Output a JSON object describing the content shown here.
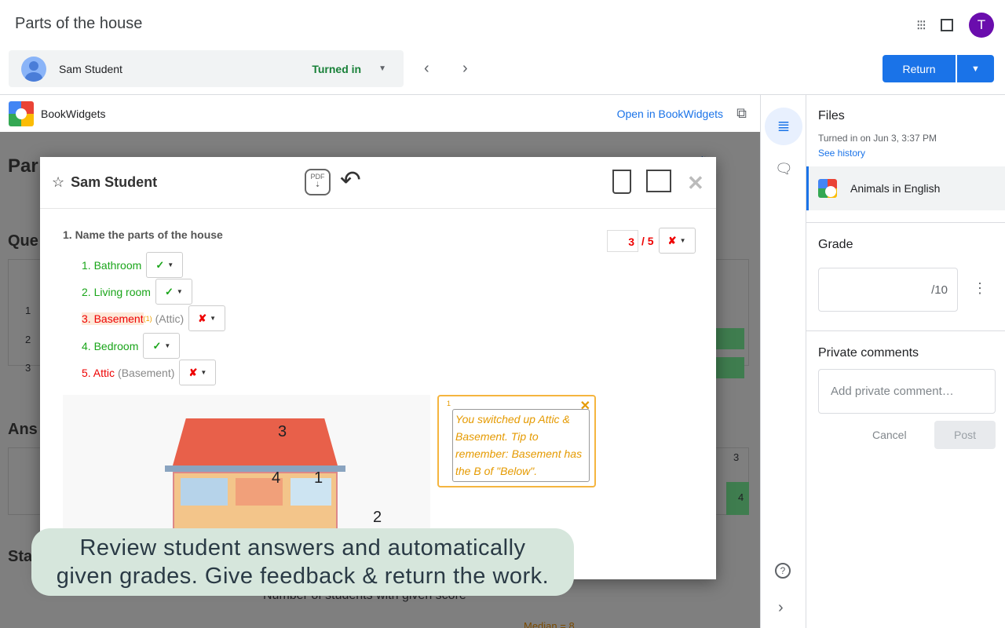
{
  "header": {
    "title": "Parts of the house",
    "avatar_letter": "T"
  },
  "student_bar": {
    "name": "Sam Student",
    "status": "Turned in"
  },
  "actions": {
    "return_label": "Return"
  },
  "bookwidgets": {
    "name": "BookWidgets",
    "open_label": "Open in BookWidgets"
  },
  "background": {
    "title_partial": "Par",
    "questions_partial": "Que",
    "answers_partial": "Ans",
    "stats_partial": "Sta",
    "results_link_partial": "sults",
    "rows": [
      "1",
      "2",
      "3"
    ],
    "chart_caption": "Number of students with given score",
    "median": "Median = 8",
    "answer_cells": [
      "3",
      "4"
    ]
  },
  "modal": {
    "student": "Sam Student",
    "question": "1. Name the parts of the house",
    "score": "3",
    "score_total": "/ 5",
    "answers": [
      {
        "label": "1. Bathroom",
        "hint": "",
        "mark": "✓",
        "correct": true
      },
      {
        "label": "2. Living room",
        "hint": "",
        "mark": "✓",
        "correct": true
      },
      {
        "label": "3. Basement",
        "footnote": "(1)",
        "hint": "(Attic)",
        "mark": "✘",
        "correct": false
      },
      {
        "label": "4. Bedroom",
        "hint": "",
        "mark": "✓",
        "correct": true
      },
      {
        "label": "5. Attic",
        "hint": "(Basement)",
        "mark": "✘",
        "correct": false
      }
    ],
    "image_labels": [
      "3",
      "4",
      "1",
      "2"
    ],
    "note": {
      "number": "1",
      "text": "You switched up Attic & Basement. Tip to remember: Basement has the B of \"Below\"."
    }
  },
  "caption": {
    "line1": "Review student answers and automatically",
    "line2": "given grades. Give feedback & return the work."
  },
  "side_panel": {
    "files_title": "Files",
    "turned_in": "Turned in on Jun 3, 3:37 PM",
    "see_history": "See history",
    "file_name": "Animals in English",
    "grade_title": "Grade",
    "grade_max": "/10",
    "comments_title": "Private comments",
    "comment_placeholder": "Add private comment…",
    "cancel": "Cancel",
    "post": "Post"
  },
  "colors": {
    "accent": "#1a73e8",
    "correct": "#1aa51a",
    "incorrect": "#e00000",
    "turned_in": "#188038",
    "note": "#e59a00"
  }
}
